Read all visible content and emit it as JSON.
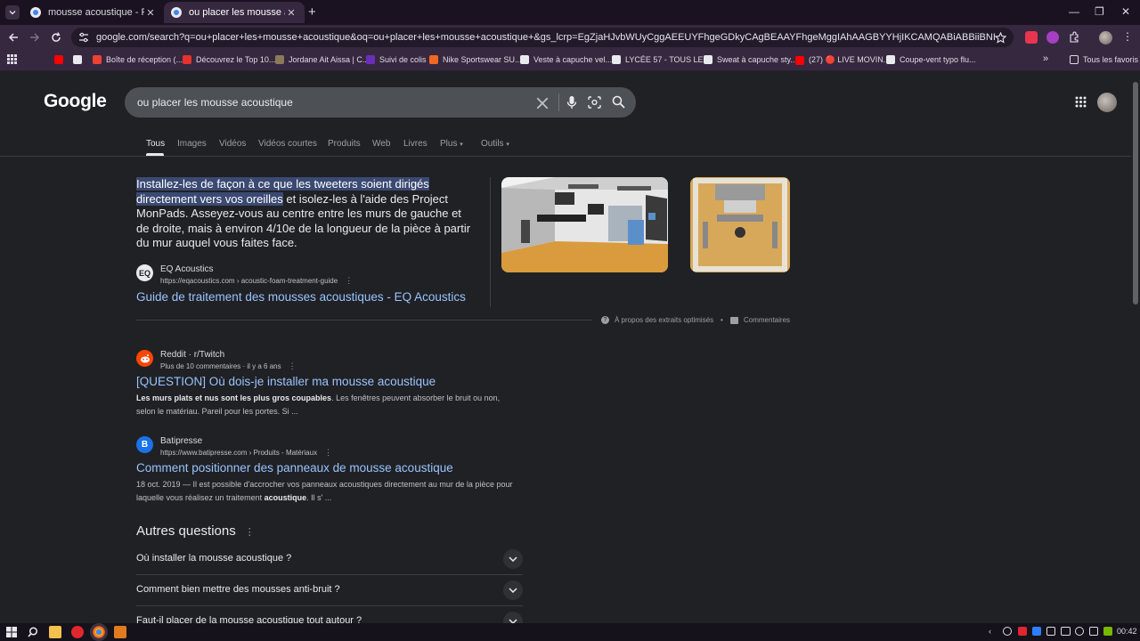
{
  "browser": {
    "tabs": [
      {
        "title": "mousse acoustique - Recherche"
      },
      {
        "title": "ou placer les mousse acoustique"
      }
    ],
    "new_tab": "+",
    "url": "google.com/search?q=ou+placer+les+mousse+acoustique&oq=ou+placer+les+mousse+acoustique+&gs_lcrp=EgZjaHJvbWUyCggAEEUYFhgeGDkyCAgBEAAYFhgeMggIAhAAGBYYHjIKCAMQABiABBiiBNIBCDQ0OTJqMGo3qAIAsAIA&sourceid...",
    "bookmarks": [
      {
        "label": "",
        "color": "#ff0000"
      },
      {
        "label": "",
        "color": "#e8eaed"
      },
      {
        "label": "Boîte de réception (...",
        "color": "#ea4335"
      },
      {
        "label": "Découvrez le Top 10...",
        "color": "#e5322d"
      },
      {
        "label": "Jordane Ait Aissa | C...",
        "color": "#8a7a5a"
      },
      {
        "label": "Suivi de colis",
        "color": "#6a2fb8"
      },
      {
        "label": "Nike Sportswear SU...",
        "color": "#f26722"
      },
      {
        "label": "Veste à capuche vel...",
        "color": "#e8eaed"
      },
      {
        "label": "LYCÉE 57 - TOUS LE...",
        "color": "#e8eaed"
      },
      {
        "label": "Sweat à capuche sty...",
        "color": "#e8eaed"
      },
      {
        "label": "(27) 🔴 LIVE MOVIN...",
        "color": "#ff0000"
      },
      {
        "label": "Coupe-vent typo flu...",
        "color": "#e8eaed"
      }
    ],
    "all_bookmarks": "Tous les favoris"
  },
  "google": {
    "logo": "Google",
    "query": "ou placer les mousse acoustique",
    "tabs": [
      "Tous",
      "Images",
      "Vidéos",
      "Vidéos courtes",
      "Produits",
      "Web",
      "Livres",
      "Plus",
      "Outils"
    ]
  },
  "featured": {
    "highlight": "Installez-les de façon à ce que les tweeters soient dirigés directement vers vos oreilles",
    "rest": " et isolez-les à l'aide des Project MonPads. Asseyez-vous au centre entre les murs de gauche et de droite, mais à environ 4/10e de la longueur de la pièce à partir du mur auquel vous faites face.",
    "source_name": "EQ Acoustics",
    "source_icon": "EQ",
    "source_cite": "https://eqacoustics.com › acoustic-foam-treatment-guide",
    "title": "Guide de traitement des mousses acoustiques - EQ Acoustics",
    "about": "À propos des extraits optimisés",
    "feedback": "Commentaires"
  },
  "results": [
    {
      "source_name": "Reddit · r/Twitch",
      "cite": "Plus de 10 commentaires · il y a 6 ans",
      "title": "[QUESTION] Où dois-je installer ma mousse acoustique",
      "snippet_bold": "Les murs plats et nus sont les plus gros coupables",
      "snippet_rest": ". Les fenêtres peuvent absorber le bruit ou non, selon le matériau. Pareil pour les portes. Si ..."
    },
    {
      "source_name": "Batipresse",
      "cite": "https://www.batipresse.com › Produits - Matériaux",
      "title": "Comment positionner des panneaux de mousse acoustique",
      "snippet_pre": "18 oct. 2019 — Il est possible d'accrocher vos panneaux acoustiques directement au mur de la pièce pour laquelle vous réalisez un traitement ",
      "snippet_bold": "acoustique",
      "snippet_rest": ". Il s' ..."
    }
  ],
  "paa": {
    "title": "Autres questions",
    "questions": [
      "Où installer la mousse acoustique ?",
      "Comment bien mettre des mousses anti-bruit ?",
      "Faut-il placer de la mousse acoustique tout autour ?"
    ]
  },
  "taskbar": {
    "clock": "00:42"
  }
}
